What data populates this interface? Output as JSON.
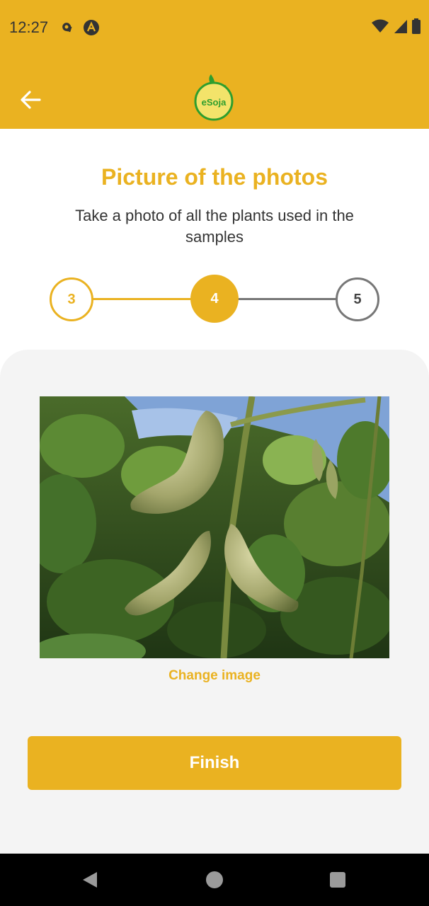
{
  "status_bar": {
    "time": "12:27",
    "icons": [
      "gear-icon",
      "a-icon",
      "wifi-icon",
      "signal-icon",
      "battery-icon"
    ]
  },
  "app_bar": {
    "logo_text": "eSoja",
    "back_icon": "back-arrow-icon"
  },
  "header": {
    "title": "Picture of the photos",
    "subtitle": "Take a photo of all the plants used in the samples"
  },
  "stepper": {
    "steps": [
      {
        "label": "3",
        "state": "completed"
      },
      {
        "label": "4",
        "state": "active"
      },
      {
        "label": "5",
        "state": "pending"
      }
    ]
  },
  "photo": {
    "subject": "soybean pods on plant"
  },
  "actions": {
    "change_image": "Change image",
    "finish": "Finish"
  },
  "nav_bar": {
    "icons": [
      "nav-back-icon",
      "nav-home-icon",
      "nav-recents-icon"
    ]
  },
  "colors": {
    "accent": "#EAB221",
    "panel_bg": "#F4F4F4",
    "inactive": "#777777"
  }
}
